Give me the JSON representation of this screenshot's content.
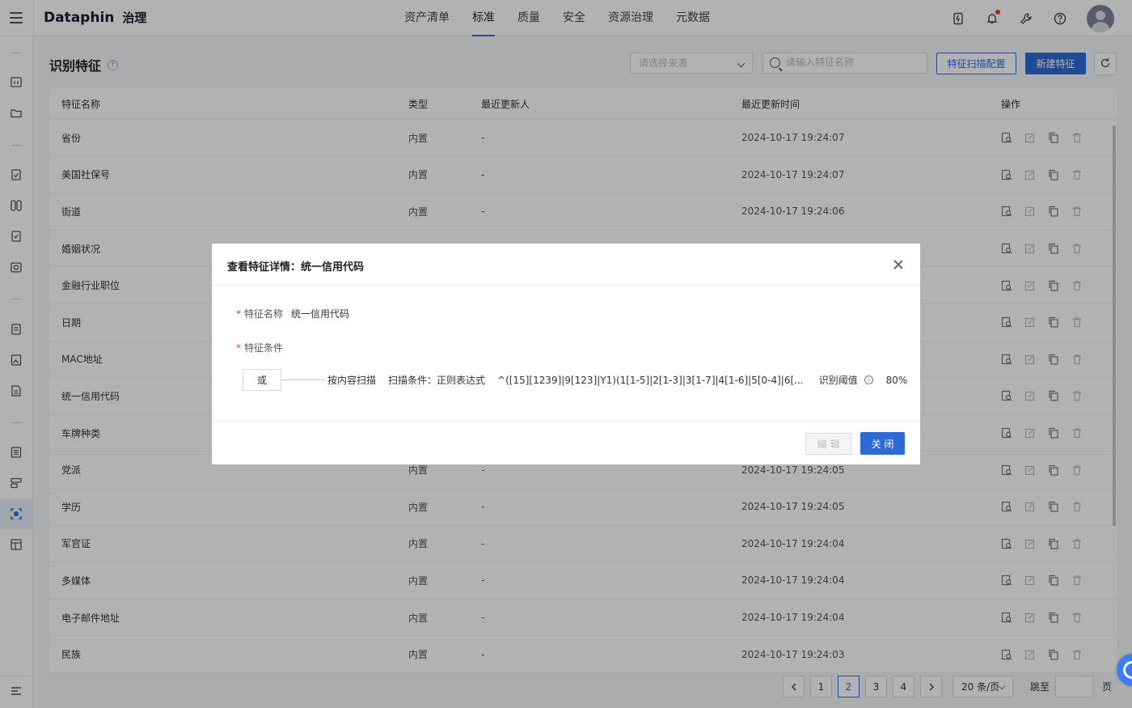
{
  "brand": {
    "name": "Dataphin",
    "sub": "治理"
  },
  "nav": [
    "资产清单",
    "标准",
    "质量",
    "安全",
    "资源治理",
    "元数据"
  ],
  "nav_active": 1,
  "page": {
    "title": "识别特征",
    "source_placeholder": "请选择来源",
    "search_placeholder": "请输入特征名称",
    "scan_config_label": "特征扫描配置",
    "new_label": "新建特征"
  },
  "table": {
    "headers": {
      "name": "特征名称",
      "type": "类型",
      "user": "最近更新人",
      "time": "最近更新时间",
      "ops": "操作"
    },
    "rows": [
      {
        "name": "省份",
        "type": "内置",
        "user": "-",
        "time": "2024-10-17 19:24:07"
      },
      {
        "name": "美国社保号",
        "type": "内置",
        "user": "-",
        "time": "2024-10-17 19:24:07"
      },
      {
        "name": "街道",
        "type": "内置",
        "user": "-",
        "time": "2024-10-17 19:24:06"
      },
      {
        "name": "婚姻状况",
        "type": "",
        "user": "",
        "time": ""
      },
      {
        "name": "金融行业职位",
        "type": "",
        "user": "",
        "time": ""
      },
      {
        "name": "日期",
        "type": "",
        "user": "",
        "time": ""
      },
      {
        "name": "MAC地址",
        "type": "",
        "user": "",
        "time": ""
      },
      {
        "name": "统一信用代码",
        "type": "",
        "user": "",
        "time": ""
      },
      {
        "name": "车牌种类",
        "type": "",
        "user": "",
        "time": ""
      },
      {
        "name": "党派",
        "type": "内置",
        "user": "-",
        "time": "2024-10-17 19:24:05"
      },
      {
        "name": "学历",
        "type": "内置",
        "user": "-",
        "time": "2024-10-17 19:24:05"
      },
      {
        "name": "军官证",
        "type": "内置",
        "user": "-",
        "time": "2024-10-17 19:24:04"
      },
      {
        "name": "多媒体",
        "type": "内置",
        "user": "-",
        "time": "2024-10-17 19:24:04"
      },
      {
        "name": "电子邮件地址",
        "type": "内置",
        "user": "-",
        "time": "2024-10-17 19:24:04"
      },
      {
        "name": "民族",
        "type": "内置",
        "user": "-",
        "time": "2024-10-17 19:24:03"
      }
    ]
  },
  "pagination": {
    "pages": [
      "1",
      "2",
      "3",
      "4"
    ],
    "current": "2",
    "page_size": "20 条/页",
    "jump_label": "跳至",
    "unit": "页"
  },
  "modal": {
    "title": "查看特征详情：统一信用代码",
    "name_label": "特征名称",
    "name_value": "统一信用代码",
    "condition_label": "特征条件",
    "or_label": "或",
    "scan_method": "按内容扫描",
    "scan_condition": "扫描条件：正则表达式",
    "regex": "^([15][1239]|9[123]|Y1)(1[1-5]|2[1-3]|3[1-7]|4[1-6]|5[0-4]|6[...",
    "threshold_label": "识别阈值",
    "threshold_value": "80%",
    "edit_label": "编 辑",
    "close_label": "关 闭"
  },
  "colors": {
    "accent": "#2d6ad6",
    "required": "#e53935"
  }
}
